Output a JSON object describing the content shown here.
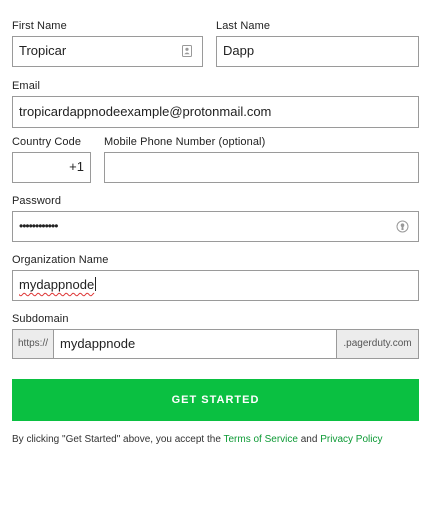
{
  "first_name": {
    "label": "First Name",
    "value": "Tropicar"
  },
  "last_name": {
    "label": "Last Name",
    "value": "Dapp"
  },
  "email": {
    "label": "Email",
    "value": "tropicardappnodeexample@protonmail.com"
  },
  "country_code": {
    "label": "Country Code",
    "value": "+1"
  },
  "mobile_phone": {
    "label": "Mobile Phone Number (optional)",
    "value": ""
  },
  "password": {
    "label": "Password",
    "value": "••••••••••••"
  },
  "organization": {
    "label": "Organization Name",
    "value": "mydappnode"
  },
  "subdomain": {
    "label": "Subdomain",
    "prefix": "https://",
    "value": "mydappnode",
    "suffix": ".pagerduty.com"
  },
  "submit": {
    "label": "GET STARTED",
    "color": "#0ac041"
  },
  "terms": {
    "prefix": "By clicking \"Get Started\" above, you accept the",
    "terms_link": "Terms of Service",
    "and": "and",
    "privacy_link": "Privacy Policy",
    "link_color": "#0d9a35"
  },
  "icons": {
    "first_name": "contact-card-icon",
    "password": "password-reveal-icon"
  }
}
